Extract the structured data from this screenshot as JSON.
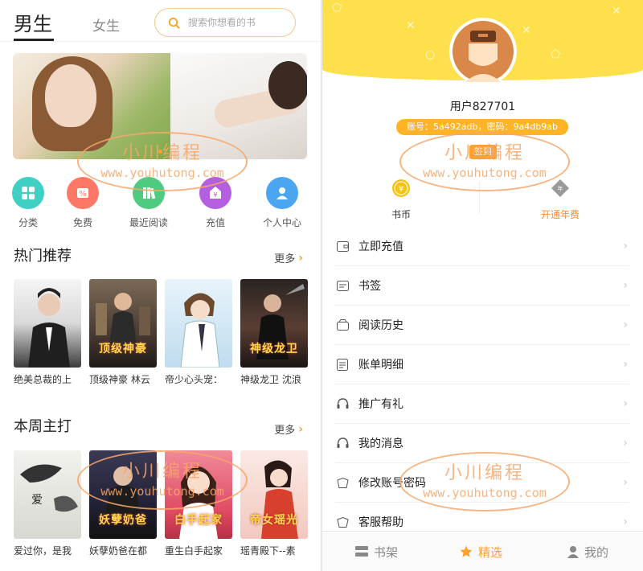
{
  "left": {
    "tabs": {
      "male": "男生",
      "female": "女生"
    },
    "search": {
      "placeholder": "搜索你想看的书"
    },
    "quick": [
      {
        "label": "分类",
        "icon": "grid-icon",
        "color": "#3fd0c4"
      },
      {
        "label": "免费",
        "icon": "percent-icon",
        "color": "#ff7767"
      },
      {
        "label": "最近阅读",
        "icon": "books-icon",
        "color": "#4ecb7f"
      },
      {
        "label": "充值",
        "icon": "bag-icon",
        "color": "#b45ee0"
      },
      {
        "label": "个人中心",
        "icon": "person-icon",
        "color": "#4aa6f0"
      }
    ],
    "hot": {
      "title": "热门推荐",
      "more": "更多",
      "books": [
        {
          "title": "绝美总裁的上",
          "cover_text": "",
          "color": "#e9e9e9"
        },
        {
          "title": "顶级神豪 林云",
          "cover_text": "顶级神豪",
          "color": "#5a4a3e"
        },
        {
          "title": "帝少心头宠：",
          "cover_text": "",
          "color": "#cfe6f5"
        },
        {
          "title": "神级龙卫 沈浪",
          "cover_text": "神级龙卫",
          "color": "#3a2e2c"
        }
      ]
    },
    "weekly": {
      "title": "本周主打",
      "more": "更多",
      "books": [
        {
          "title": "爱过你，是我",
          "cover_text": "",
          "color": "#ecece8"
        },
        {
          "title": "妖孽奶爸在都",
          "cover_text": "妖孽奶爸",
          "color": "#2c2a3e"
        },
        {
          "title": "重生白手起家",
          "cover_text": "白手起家",
          "color": "#e7566b"
        },
        {
          "title": "瑶青殿下--素",
          "cover_text": "帝女瑶光",
          "color": "#f4d8d2"
        }
      ]
    },
    "watermark": {
      "line1": "小川编程",
      "line2": "www.youhutong.com"
    }
  },
  "right": {
    "username": "用户827701",
    "account": "账号：5a492adb，密码：9a4db9ab",
    "signin": "签到",
    "coins_label": "书币",
    "annual_label": "开通年费",
    "menu": [
      {
        "label": "立即充值",
        "icon": "wallet-icon"
      },
      {
        "label": "书签",
        "icon": "bookmark-icon"
      },
      {
        "label": "阅读历史",
        "icon": "history-icon"
      },
      {
        "label": "账单明细",
        "icon": "bill-icon"
      },
      {
        "label": "推广有礼",
        "icon": "headset-icon"
      },
      {
        "label": "我的消息",
        "icon": "message-icon"
      },
      {
        "label": "修改账号密码",
        "icon": "lock-icon"
      },
      {
        "label": "客服帮助",
        "icon": "help-icon"
      }
    ],
    "bottom_nav": [
      {
        "label": "书架",
        "icon": "shelf-icon",
        "active": false
      },
      {
        "label": "精选",
        "icon": "star-icon",
        "active": true
      },
      {
        "label": "我的",
        "icon": "user-icon",
        "active": false
      }
    ],
    "accent": "#ff9f2e",
    "hero_color": "#fde04b",
    "watermark": {
      "line1": "小川编程",
      "line2": "www.youhutong.com"
    }
  }
}
